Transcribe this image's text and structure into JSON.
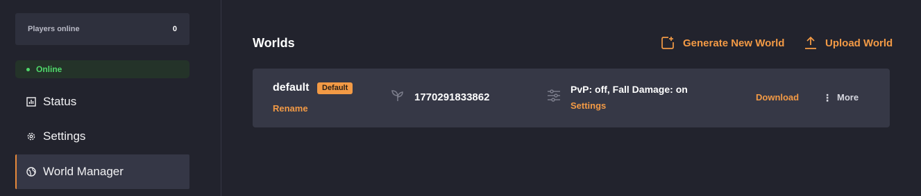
{
  "sidebar": {
    "players_online": {
      "label": "Players online",
      "count": "0"
    },
    "status_pill": {
      "label": "Online",
      "color": "#4fd86a"
    },
    "nav": {
      "status": {
        "label": "Status",
        "icon": "bar-chart-icon"
      },
      "settings": {
        "label": "Settings",
        "icon": "gear-icon"
      },
      "world_manager": {
        "label": "World Manager",
        "icon": "globe-icon",
        "active": true
      }
    }
  },
  "main": {
    "title": "Worlds",
    "actions": {
      "generate": {
        "label": "Generate New World",
        "icon": "new-world-icon"
      },
      "upload": {
        "label": "Upload World",
        "icon": "upload-icon"
      }
    },
    "worlds": [
      {
        "name": "default",
        "badge": "Default",
        "rename_label": "Rename",
        "seed_icon": "sprout-icon",
        "seed": "1770291833862",
        "settings_icon": "sliders-icon",
        "settings_summary": "PvP: off, Fall Damage: on",
        "settings_label": "Settings",
        "download_label": "Download",
        "more_label": "More"
      }
    ]
  },
  "colors": {
    "background": "#22232d",
    "card": "#363846",
    "accent": "#f39a45",
    "online": "#4fd86a"
  }
}
